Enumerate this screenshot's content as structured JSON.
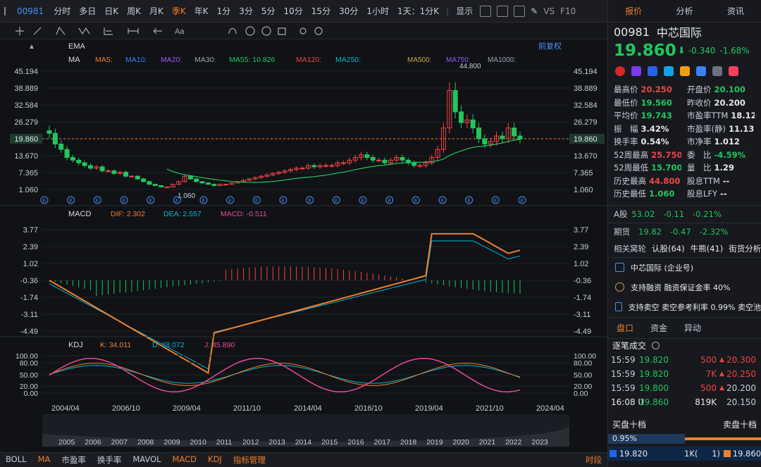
{
  "topbar": {
    "symbol": "00981",
    "periods": [
      "分时",
      "多日",
      "日K",
      "周K",
      "月K",
      "季K",
      "年K",
      "1分",
      "3分",
      "5分",
      "10分",
      "15分",
      "30分",
      "1小时",
      "1天：1分K"
    ],
    "active_period": "季K",
    "display_label": "显示",
    "vs_label": "VS",
    "f10_label": "F10"
  },
  "legend": {
    "ema_label": "EMA",
    "ma_label": "MA",
    "ma_items": [
      "MA5:",
      "MA10:",
      "MA20:",
      "MA30:",
      "MA55: 10.826",
      "MA120:",
      "MA250:"
    ],
    "ma_colors": [
      "#f07f2a",
      "#3b82f6",
      "#a855f7",
      "#9ca3af",
      "#22c55e",
      "#ef4444",
      "#06b6d4"
    ],
    "ma500_label": "MA500:",
    "ma750_label": "MA750:",
    "ma1000_label": "MA1000:",
    "adjust_label": "前复权",
    "macd_label": "MACD",
    "dif": "DIF: 2.302",
    "dea": "DEA: 2.557",
    "macd": "MACD: -0.511",
    "kdj_label": "KDJ",
    "k": "K: 34.011",
    "d": "D: 28.072",
    "j": "J: 45.890"
  },
  "price_axis": [
    "45.194",
    "38.889",
    "32.584",
    "26.279",
    "19.860",
    "13.670",
    "7.365",
    "1.060"
  ],
  "current_price_tag": "19.860",
  "high_annotation": "44.800",
  "low_annotation": "1.060",
  "macd_axis": [
    "3.77",
    "2.39",
    "1.02",
    "-0.36",
    "-1.74",
    "-3.11",
    "-4.49"
  ],
  "kdj_axis": [
    "100.00",
    "80.00",
    "50.00",
    "20.00",
    "0.00"
  ],
  "date_axis": [
    "2004/04",
    "2006/10",
    "2009/04",
    "2011/10",
    "2014/04",
    "2016/10",
    "2019/04",
    "2021/10",
    "2024/04"
  ],
  "year_axis": [
    "2005",
    "2006",
    "2007",
    "2008",
    "2009",
    "2010",
    "2011",
    "2012",
    "2013",
    "2014",
    "2015",
    "2016",
    "2017",
    "2018",
    "2019",
    "2020",
    "2021",
    "2022",
    "2023"
  ],
  "event_marker": "E",
  "bottombar": {
    "items": [
      "BOLL",
      "MA",
      "市盈率",
      "换手率",
      "MAVOL",
      "MACD",
      "KDJ",
      "指标管理"
    ],
    "right": "时段"
  },
  "right": {
    "tabs": [
      "报价",
      "分析",
      "资讯"
    ],
    "code": "00981",
    "name": "中芯国际",
    "price": "19.860",
    "arrow": "⬇",
    "change": "-0.340",
    "change_pct": "-1.68%",
    "quotes": [
      [
        "最高价",
        "20.250",
        "开盘价",
        "20.100"
      ],
      [
        "最低价",
        "19.560",
        "昨收价",
        "20.200"
      ],
      [
        "平均价",
        "19.743",
        "市盈率TTM",
        "18.12"
      ],
      [
        "振　幅",
        "3.42%",
        "市盈率(静)",
        "11.13"
      ],
      [
        "换手率",
        "0.54%",
        "市净率",
        "1.012"
      ],
      [
        "52周最高",
        "25.750",
        "委　比",
        "-4.59%"
      ],
      [
        "52周最低",
        "15.700",
        "量　比",
        "1.29"
      ],
      [
        "历史最高",
        "44.800",
        "股息TTM",
        "--"
      ],
      [
        "历史最低",
        "1.060",
        "股息LFY",
        "--"
      ]
    ],
    "a_share": {
      "label": "A股",
      "price": "53.02",
      "chg": "-0.11",
      "pct": "-0.21%"
    },
    "futures": {
      "label": "期货",
      "price": "19.82",
      "chg": "-0.47",
      "pct": "-2.32%"
    },
    "warrants": [
      "相关窝轮",
      "认股(64)",
      "牛熊(41)",
      "街货分析"
    ],
    "info_rows": [
      "中芯国际 (企业号)",
      "支持融资 融资保证金率 40%",
      "支持卖空 卖空参考利率 0.99% 卖空池"
    ],
    "subtabs": [
      "盘口",
      "资金",
      "异动"
    ],
    "ticks_title": "逐笔成交",
    "ticks": [
      [
        "15:59",
        "19.820",
        "500"
      ],
      [
        "15:59",
        "19.820",
        "7K"
      ],
      [
        "15:59",
        "19.800",
        "500"
      ],
      [
        "16:08 U",
        "19.860",
        "819K"
      ]
    ],
    "book_prices": [
      "20.300",
      "20.250",
      "20.200",
      "20.150"
    ],
    "bid_title": "买盘十档",
    "ask_title": "卖盘十档",
    "ratio": "0.95%",
    "bid_row": [
      "19.820",
      "1K(",
      "1)",
      "19.860"
    ]
  }
}
